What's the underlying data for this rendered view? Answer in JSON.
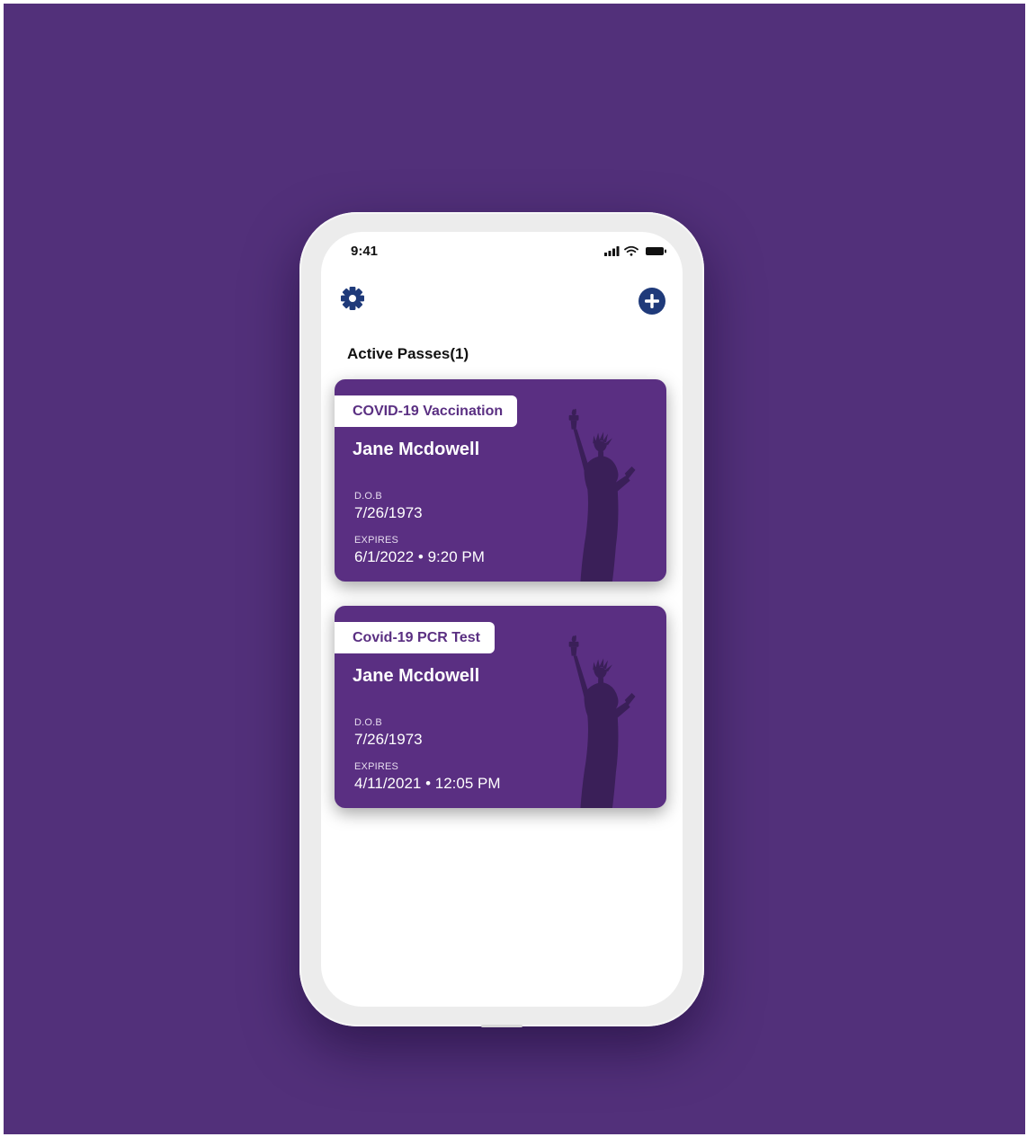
{
  "status_bar": {
    "time": "9:41"
  },
  "header": {
    "settings_icon": "gear-icon",
    "add_icon": "plus-circle-icon"
  },
  "section_title": "Active Passes(1)",
  "passes": [
    {
      "type": "COVID-19 Vaccination",
      "name": "Jane Mcdowell",
      "dob_label": "D.O.B",
      "dob": "7/26/1973",
      "expires_label": "EXPIRES",
      "expires": "6/1/2022 • 9:20 PM"
    },
    {
      "type": "Covid-19 PCR Test",
      "name": "Jane Mcdowell",
      "dob_label": "D.O.B",
      "dob": "7/26/1973",
      "expires_label": "EXPIRES",
      "expires": "4/11/2021 • 12:05 PM"
    }
  ],
  "colors": {
    "background": "#52307a",
    "card": "#5a2f82",
    "icon_accent": "#1f3a7a",
    "statue": "#3a1f58"
  }
}
